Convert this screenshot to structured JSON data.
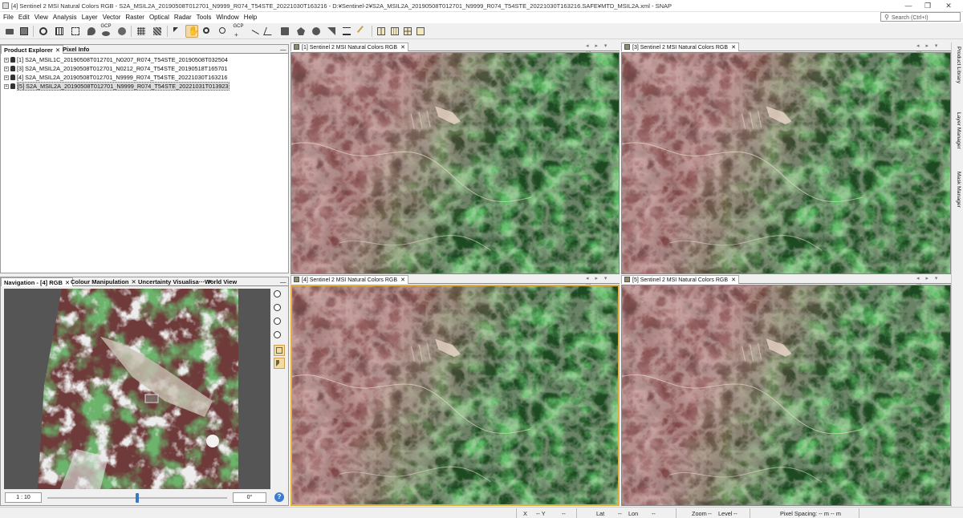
{
  "window": {
    "title": "[4] Sentinel 2 MSI Natural Colors RGB - S2A_MSIL2A_20190508T012701_N9999_R074_T54STE_20221030T163216 - D:¥Sentinel-2¥S2A_MSIL2A_20190508T012701_N9999_R074_T54STE_20221030T163216.SAFE¥MTD_MSIL2A.xml - SNAP",
    "minimize": "—",
    "restore": "❐",
    "close": "✕"
  },
  "menu": {
    "items": [
      "File",
      "Edit",
      "View",
      "Analysis",
      "Layer",
      "Vector",
      "Raster",
      "Optical",
      "Radar",
      "Tools",
      "Window",
      "Help"
    ],
    "search_placeholder": "Search (Ctrl+I)"
  },
  "toolbar": {
    "gcp_label_1": "GCP",
    "gcp_label_2": "GCP"
  },
  "product_explorer": {
    "tabs": [
      {
        "label": "Product Explorer",
        "close": "✕"
      },
      {
        "label": "Pixel Info"
      }
    ],
    "minimize": "—",
    "products": [
      {
        "label": "[1] S2A_MSIL1C_20190508T012701_N0207_R074_T54STE_20190508T032504"
      },
      {
        "label": "[3] S2A_MSIL2A_20190508T012701_N0212_R074_T54STE_20190518T165701"
      },
      {
        "label": "[4] S2A_MSIL2A_20190508T012701_N9999_R074_T54STE_20221030T163216"
      },
      {
        "label": "[5] S2A_MSIL2A_20190508T012701_N9999_R074_T54STE_20221031T013923"
      }
    ]
  },
  "navigation": {
    "tabs": [
      {
        "label": "Navigation - [4] RGB",
        "close": "✕"
      },
      {
        "label": "Colour Manipulation",
        "close": "✕"
      },
      {
        "label": "Uncertainty Visualisa···",
        "close": "✕"
      },
      {
        "label": "World View"
      }
    ],
    "minimize": "—",
    "scale": "1 : 10",
    "slider_fraction": 0.5,
    "rotation": "0°",
    "help": "?"
  },
  "views": [
    {
      "tab": "[1] Sentinel 2 MSI Natural Colors RGB",
      "close": "✕"
    },
    {
      "tab": "[3] Sentinel 2 MSI Natural Colors RGB",
      "close": "✕"
    },
    {
      "tab": "[4] Sentinel 2 MSI Natural Colors RGB",
      "close": "✕"
    },
    {
      "tab": "[5] Sentinel 2 MSI Natural Colors RGB",
      "close": "✕"
    }
  ],
  "view_controls": "◂ ▸ ▾ ▭",
  "right_tabs": [
    "Product Library",
    "Layer Manager",
    "Mask Manager"
  ],
  "status": {
    "x_label": "X",
    "x_value": "-- Y",
    "y_value": "--",
    "lat_label": "Lat",
    "lat_value": "--",
    "lon_label": "Lon",
    "lon_value": "--",
    "zoom_label": "Zoom",
    "zoom_value": "--",
    "level_label": "Level",
    "level_value": "--",
    "spacing_label": "Pixel Spacing:",
    "spacing_value": "-- m -- m"
  },
  "colors": {
    "accent_selected": "#e0b040",
    "vegetation": "#2f7a2f",
    "bare_soil": "#7a3838"
  }
}
